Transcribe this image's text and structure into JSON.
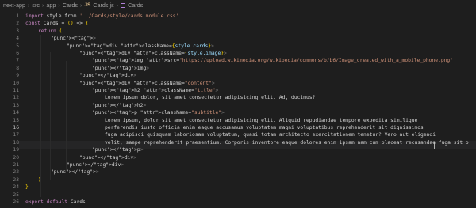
{
  "breadcrumb": {
    "items": [
      "next-app",
      "src",
      "app",
      "Cards",
      "Cards.js",
      "Cards"
    ],
    "js_label": "JS"
  },
  "editor": {
    "active_line": 16,
    "lines": [
      {
        "n": "1",
        "t": "import style from '../Cards/style/cards.module.css'"
      },
      {
        "n": "2",
        "t": "const Cards = () => {"
      },
      {
        "n": "3",
        "t": "return ("
      },
      {
        "n": "4",
        "t": "<>"
      },
      {
        "n": "5",
        "t": "<div className={style.cards}>"
      },
      {
        "n": "6",
        "t": "<div className={style.image}>"
      },
      {
        "n": "7",
        "t": "<img src=\"https://upload.wikimedia.org/wikipedia/commons/b/b6/Image_created_with_a_mobile_phone.png\""
      },
      {
        "n": "8",
        "t": "</img>"
      },
      {
        "n": "9",
        "t": "</div>"
      },
      {
        "n": "10",
        "t": "<div className=\"content\">"
      },
      {
        "n": "11",
        "t": "<h2 className=\"title\">"
      },
      {
        "n": "12",
        "t": "Lorem ipsum dolor, sit amet consectetur adipisicing elit. Ad, ducimus?"
      },
      {
        "n": "13",
        "t": "</h2>"
      },
      {
        "n": "14",
        "t": "<p className=\"subtitle\">"
      },
      {
        "n": "15",
        "t": "Lorem ipsum, dolor sit amet consectetur adipisicing elit. Aliquid repudiandae tempore expedita similique"
      },
      {
        "n": "16",
        "t": "perferendis iusto officia enim eaque accusamus voluptatem magni voluptatibus reprehenderit sit dignissimos"
      },
      {
        "n": "17",
        "t": "fuga adipisci quisquam laboriosam voluptatum, quasi totam architecto exercitationem tenetur? Vero aut eligendi"
      },
      {
        "n": "18",
        "t": "velit, saepe reprehenderit praesentium. Corporis inventore eaque dolores enim ipsam nam cum placeat recusandae fuga sit o"
      },
      {
        "n": "19",
        "t": "</p>"
      },
      {
        "n": "20",
        "t": "</div>"
      },
      {
        "n": "21",
        "t": "</div>"
      },
      {
        "n": "22",
        "t": "</>"
      },
      {
        "n": "23",
        "t": ")"
      },
      {
        "n": "24",
        "t": "}"
      },
      {
        "n": "25",
        "t": ""
      },
      {
        "n": "26",
        "t": "export default Cards"
      }
    ]
  }
}
